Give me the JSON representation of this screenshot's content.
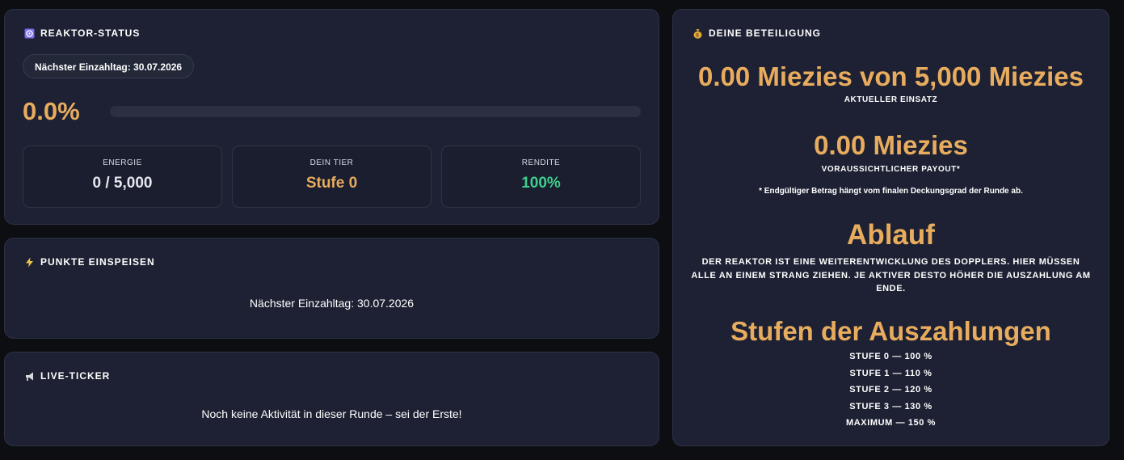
{
  "reaktor_status": {
    "icon": "atom-icon",
    "title": "REAKTOR-STATUS",
    "next_deposit_day": "Nächster Einzahltag: 30.07.2026",
    "progress_text": "0.0%",
    "progress_value": 0.0,
    "stats": [
      {
        "label": "ENERGIE",
        "value": "0 / 5,000",
        "color": "#e6e8ef"
      },
      {
        "label": "DEIN TIER",
        "value": "Stufe 0",
        "color": "#e8ac5e"
      },
      {
        "label": "RENDITE",
        "value": "100%",
        "color": "#3ecf8e"
      }
    ]
  },
  "punkte": {
    "icon": "lightning-icon",
    "title": "PUNKTE EINSPEISEN",
    "message": "Nächster Einzahltag: 30.07.2026"
  },
  "ticker": {
    "icon": "megaphone-icon",
    "title": "LIVE-TICKER",
    "message": "Noch keine Aktivität in dieser Runde – sei der Erste!"
  },
  "beteiligung": {
    "icon": "money-bag-icon",
    "title": "DEINE BETEILIGUNG",
    "stake_amount": "0.00 Miezies von 5,000 Miezies",
    "stake_label": "AKTUELLER EINSATZ",
    "payout_amount": "0.00 Miezies",
    "payout_label": "VORAUSSICHTLICHER PAYOUT*",
    "payout_note": "* Endgültiger Betrag hängt vom finalen Deckungsgrad der Runde ab.",
    "process_heading": "Ablauf",
    "process_text": "DER REAKTOR IST EINE WEITERENTWICKLUNG DES DOPPLERS. HIER MÜSSEN ALLE AN EINEM STRANG ZIEHEN. JE AKTIVER DESTO HÖHER DIE AUSZAHLUNG AM ENDE.",
    "tiers_heading": "Stufen der Auszahlungen",
    "tiers": [
      "STUFE 0 — 100 %",
      "STUFE 1 — 110 %",
      "STUFE 2 — 120 %",
      "STUFE 3 — 130 %",
      "MAXIMUM — 150 %"
    ]
  },
  "colors": {
    "accent": "#e8ac5e",
    "success": "#3ecf8e",
    "card_bg": "#1d2133",
    "page_bg": "#0d0e12"
  }
}
